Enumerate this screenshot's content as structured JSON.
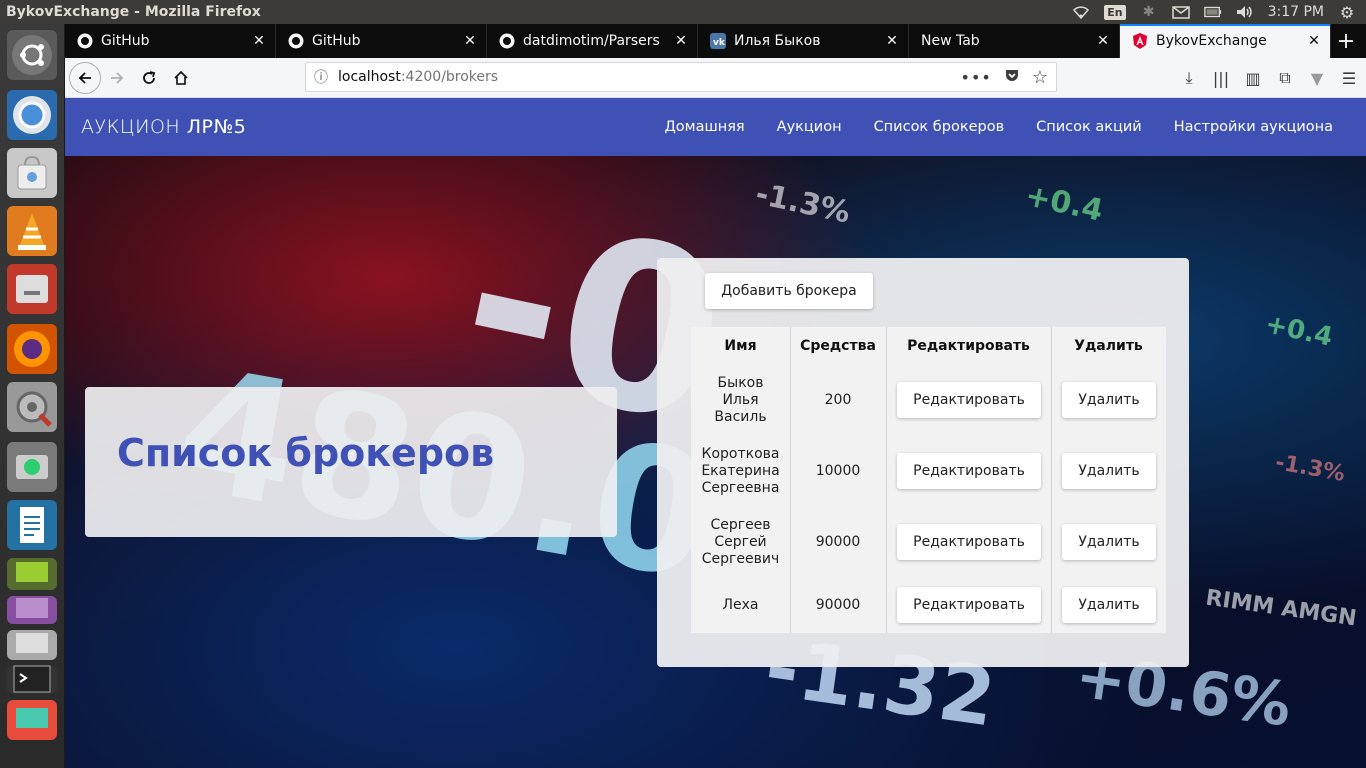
{
  "os": {
    "window_title": "BykovExchange - Mozilla Firefox",
    "keyboard_layout": "En",
    "clock": "3:17 PM"
  },
  "browser": {
    "tabs": [
      {
        "label": "GitHub",
        "favicon": "github-icon"
      },
      {
        "label": "GitHub",
        "favicon": "github-icon"
      },
      {
        "label": "datdimotim/Parsers",
        "favicon": "github-icon"
      },
      {
        "label": "Илья Быков",
        "favicon": "vk-icon"
      },
      {
        "label": "New Tab",
        "favicon": ""
      },
      {
        "label": "BykovExchange",
        "favicon": "angular-icon"
      }
    ],
    "url_host": "localhost",
    "url_rest": ":4200/brokers"
  },
  "app": {
    "brand_a": "АУКЦИОН ",
    "brand_b": "ЛР№5",
    "nav": [
      "Домашняя",
      "Аукцион",
      "Список брокеров",
      "Список акций",
      "Настройки аукциона"
    ],
    "hero_title": "Список брокеров",
    "add_button": "Добавить брокера",
    "table": {
      "headers": [
        "Имя",
        "Средства",
        "Редактировать",
        "Удалить"
      ],
      "rows": [
        {
          "name": "Быков\nИлья\nВасиль",
          "funds": "200",
          "edit": "Редактировать",
          "delete": "Удалить"
        },
        {
          "name": "Короткова\nЕкатерина\nСергеевна",
          "funds": "10000",
          "edit": "Редактировать",
          "delete": "Удалить"
        },
        {
          "name": "Сергеев\nСергей\nСергеевич",
          "funds": "90000",
          "edit": "Редактировать",
          "delete": "Удалить"
        },
        {
          "name": "Леха",
          "funds": "90000",
          "edit": "Редактировать",
          "delete": "Удалить"
        }
      ]
    }
  }
}
